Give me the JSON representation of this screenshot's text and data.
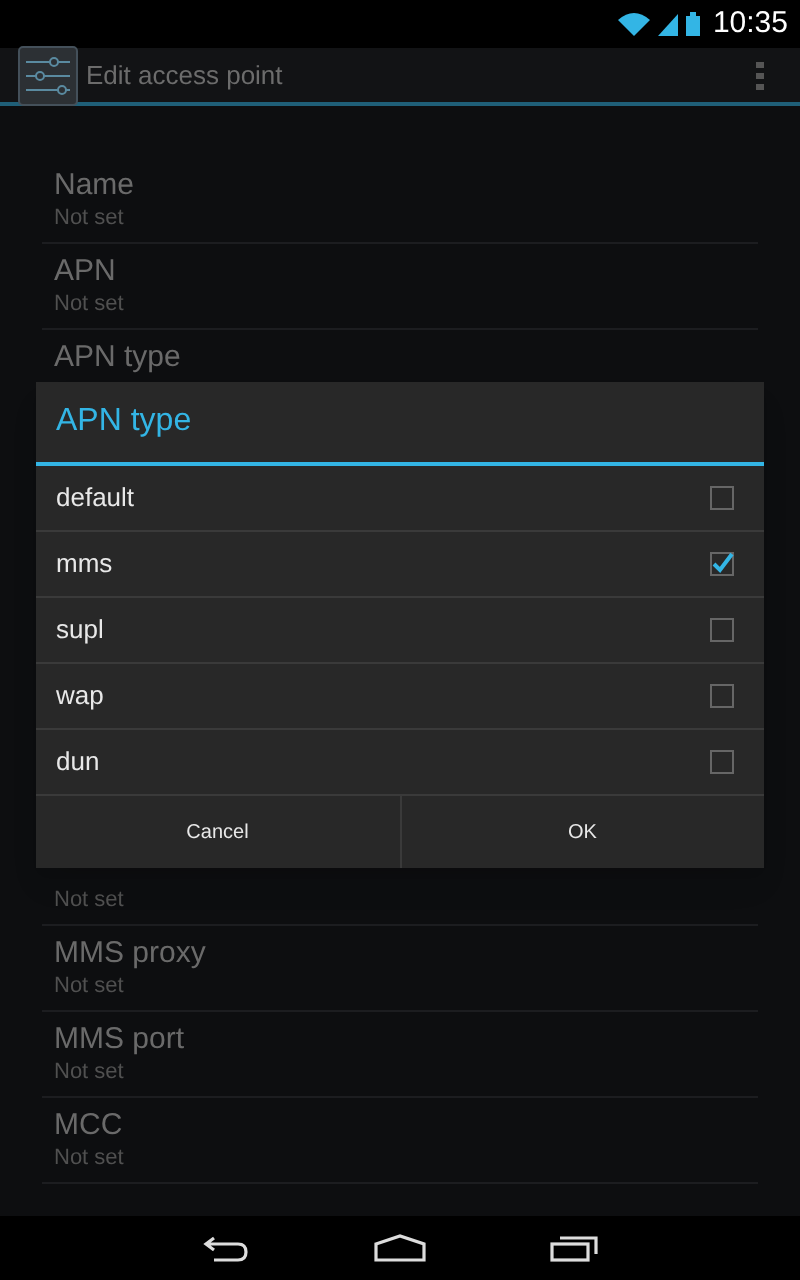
{
  "status_bar": {
    "time": "10:35"
  },
  "action_bar": {
    "title": "Edit access point"
  },
  "settings_top": [
    {
      "title": "Name",
      "summary": "Not set"
    },
    {
      "title": "APN",
      "summary": "Not set"
    },
    {
      "title": "APN type"
    }
  ],
  "settings_bottom": [
    {
      "summary": "Not set"
    },
    {
      "title": "MMS proxy",
      "summary": "Not set"
    },
    {
      "title": "MMS port",
      "summary": "Not set"
    },
    {
      "title": "MCC",
      "summary": "Not set"
    }
  ],
  "dialog": {
    "title": "APN type",
    "options": [
      {
        "label": "default",
        "checked": false
      },
      {
        "label": "mms",
        "checked": true
      },
      {
        "label": "supl",
        "checked": false
      },
      {
        "label": "wap",
        "checked": false
      },
      {
        "label": "dun",
        "checked": false
      }
    ],
    "buttons": [
      "Cancel",
      "OK"
    ]
  }
}
